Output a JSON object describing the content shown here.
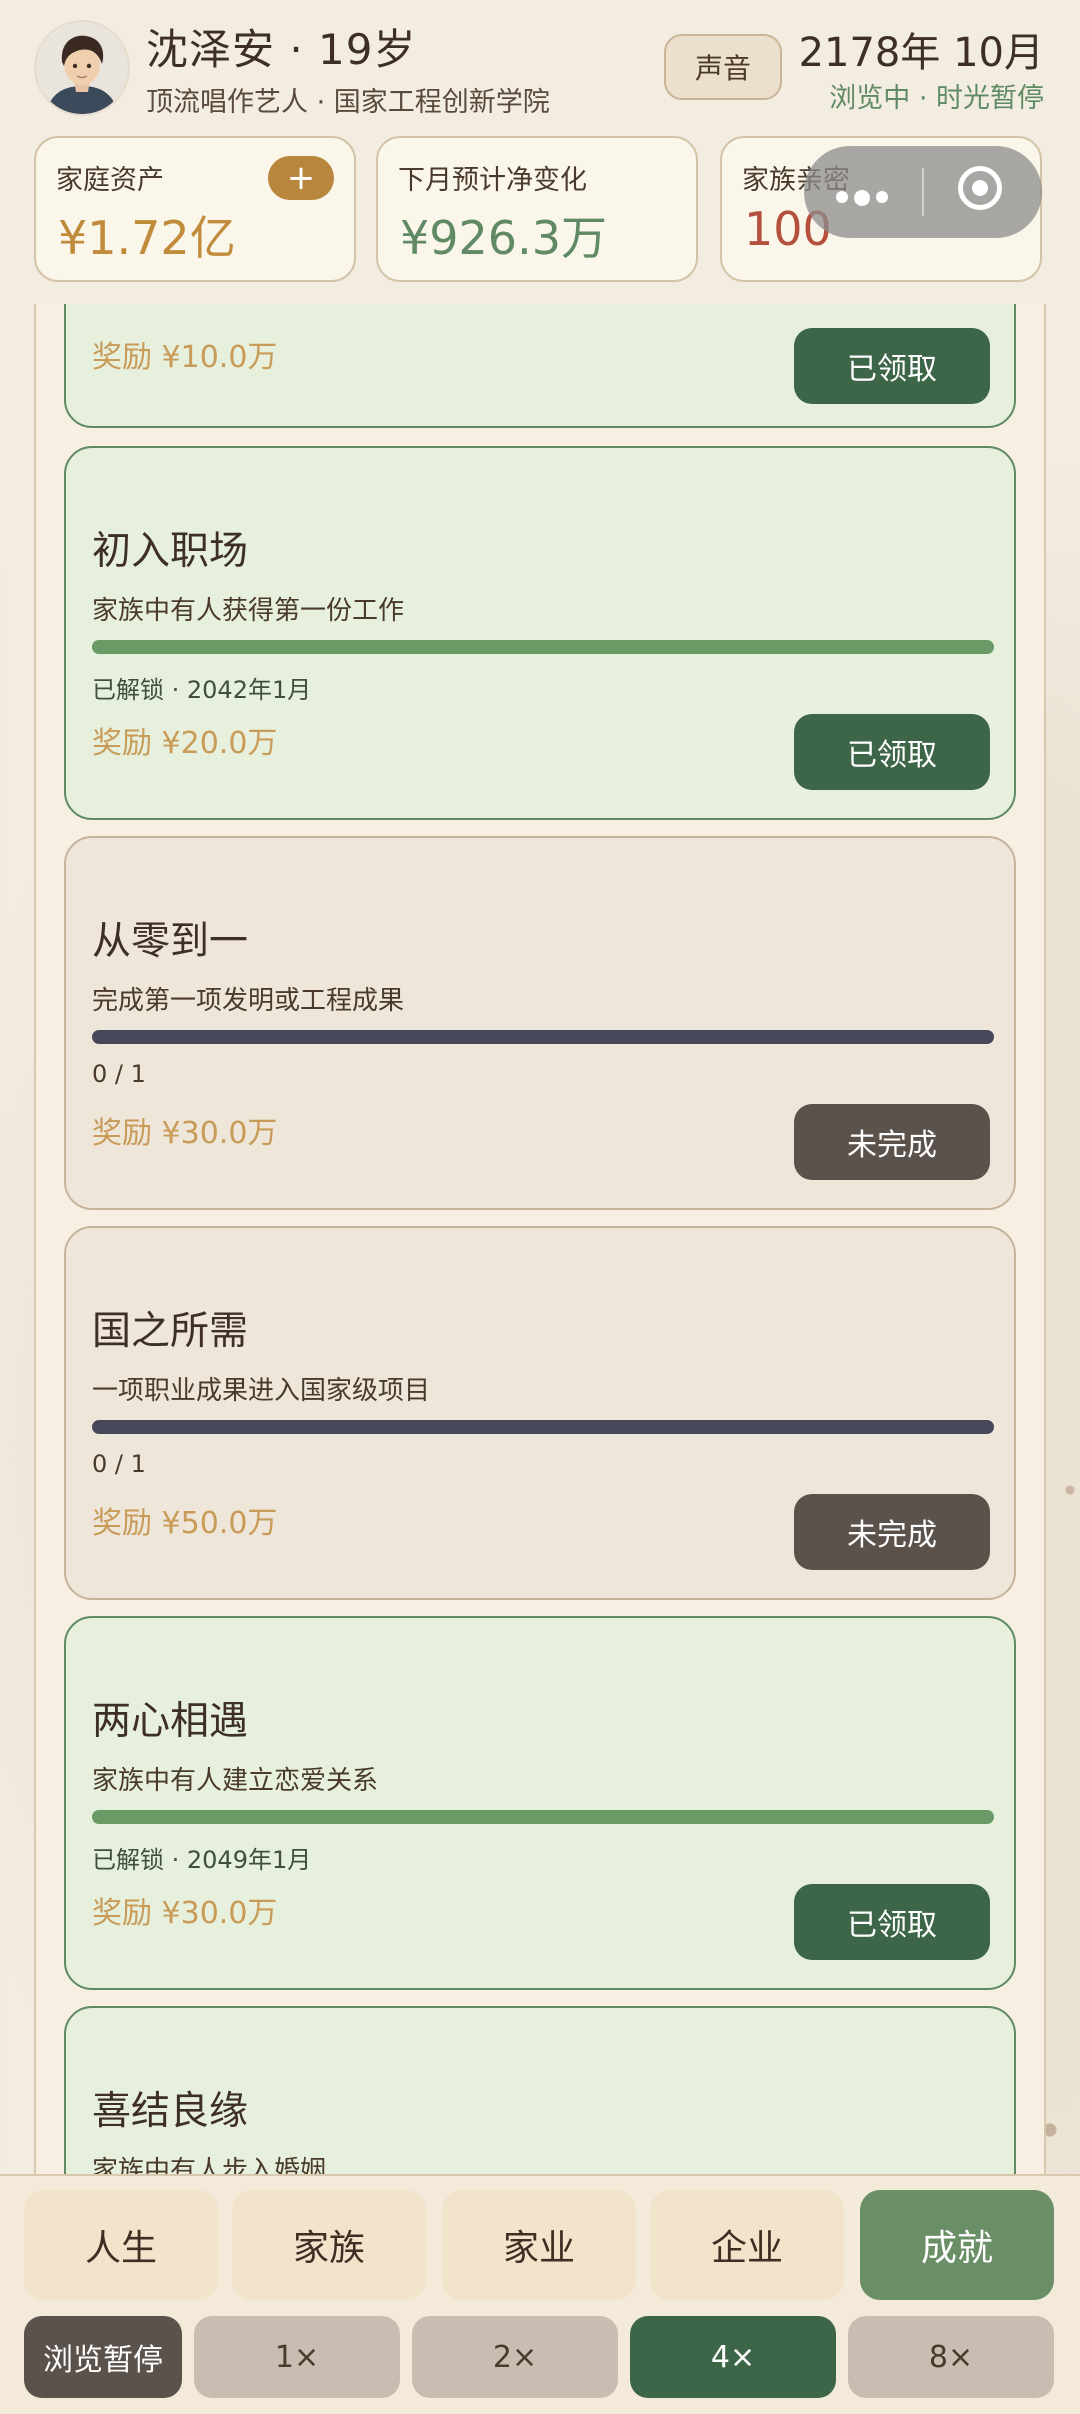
{
  "header": {
    "name": "沈泽安 · 19岁",
    "subtitle": "顶流唱作艺人 · 国家工程创新学院",
    "sound_label": "声音",
    "date": "2178年 10月",
    "status": "浏览中 · 时光暂停"
  },
  "stats": [
    {
      "label": "家庭资产",
      "value": "¥1.72亿",
      "color": "#c08c3c"
    },
    {
      "label": "下月预计净变化",
      "value": "¥926.3万",
      "color": "#5f8a63"
    },
    {
      "label": "家族亲密",
      "value": "100",
      "color": "#b4503c"
    }
  ],
  "add_button": "+",
  "achievements": [
    {
      "title": "",
      "desc": "",
      "meta": "",
      "reward": "奖励 ¥10.0万",
      "button": "已领取",
      "state": "done",
      "progress": 1
    },
    {
      "title": "初入职场",
      "desc": "家族中有人获得第一份工作",
      "meta": "已解锁 · 2042年1月",
      "reward": "奖励 ¥20.0万",
      "button": "已领取",
      "state": "done",
      "progress": 1
    },
    {
      "title": "从零到一",
      "desc": "完成第一项发明或工程成果",
      "meta": "0 / 1",
      "reward": "奖励 ¥30.0万",
      "button": "未完成",
      "state": "todo",
      "progress": 0
    },
    {
      "title": "国之所需",
      "desc": "一项职业成果进入国家级项目",
      "meta": "0 / 1",
      "reward": "奖励 ¥50.0万",
      "button": "未完成",
      "state": "todo",
      "progress": 0
    },
    {
      "title": "两心相遇",
      "desc": "家族中有人建立恋爱关系",
      "meta": "已解锁 · 2049年1月",
      "reward": "奖励 ¥30.0万",
      "button": "已领取",
      "state": "done",
      "progress": 1
    },
    {
      "title": "喜结良缘",
      "desc": "家族中有人步入婚姻",
      "meta": "",
      "reward": "",
      "button": "",
      "state": "done",
      "progress": 1
    }
  ],
  "tabs": [
    {
      "label": "人生",
      "active": false
    },
    {
      "label": "家族",
      "active": false
    },
    {
      "label": "家业",
      "active": false
    },
    {
      "label": "企业",
      "active": false
    },
    {
      "label": "成就",
      "active": true
    }
  ],
  "speed_controls": [
    {
      "label": "浏览暂停",
      "kind": "pause"
    },
    {
      "label": "1×",
      "kind": "normal"
    },
    {
      "label": "2×",
      "kind": "normal"
    },
    {
      "label": "4×",
      "kind": "active"
    },
    {
      "label": "8×",
      "kind": "normal"
    }
  ]
}
